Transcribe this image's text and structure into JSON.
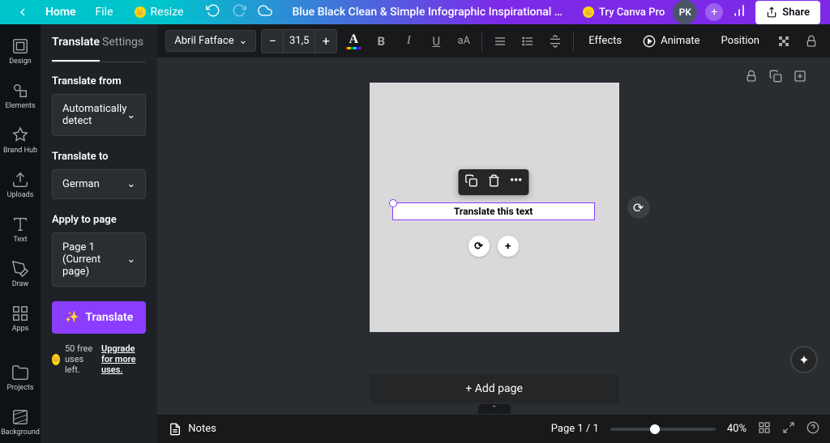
{
  "topbar": {
    "home": "Home",
    "file": "File",
    "resize": "Resize",
    "doc_title": "Blue Black Clean & Simple Infographic Inspirational Square ...",
    "try_pro": "Try Canva Pro",
    "avatar_initials": "PK",
    "share": "Share"
  },
  "nav": {
    "design": "Design",
    "elements": "Elements",
    "brand_hub": "Brand Hub",
    "uploads": "Uploads",
    "text": "Text",
    "draw": "Draw",
    "apps": "Apps",
    "projects": "Projects",
    "background": "Background"
  },
  "panel": {
    "tab_translate": "Translate",
    "tab_settings": "Settings",
    "translate_from_label": "Translate from",
    "translate_from_value": "Automatically detect",
    "translate_to_label": "Translate to",
    "translate_to_value": "German",
    "apply_label": "Apply to page",
    "apply_value": "Page 1 (Current page)",
    "translate_btn": "Translate",
    "uses_left": "50 free uses left.",
    "upgrade": "Upgrade for more uses."
  },
  "toolbar": {
    "font": "Abril Fatface",
    "size": "31,5",
    "effects": "Effects",
    "animate": "Animate",
    "position": "Position"
  },
  "canvas": {
    "text_content": "Translate this text",
    "add_page": "+ Add page"
  },
  "bottombar": {
    "notes": "Notes",
    "page_indicator": "Page 1 / 1",
    "zoom": "40%"
  }
}
